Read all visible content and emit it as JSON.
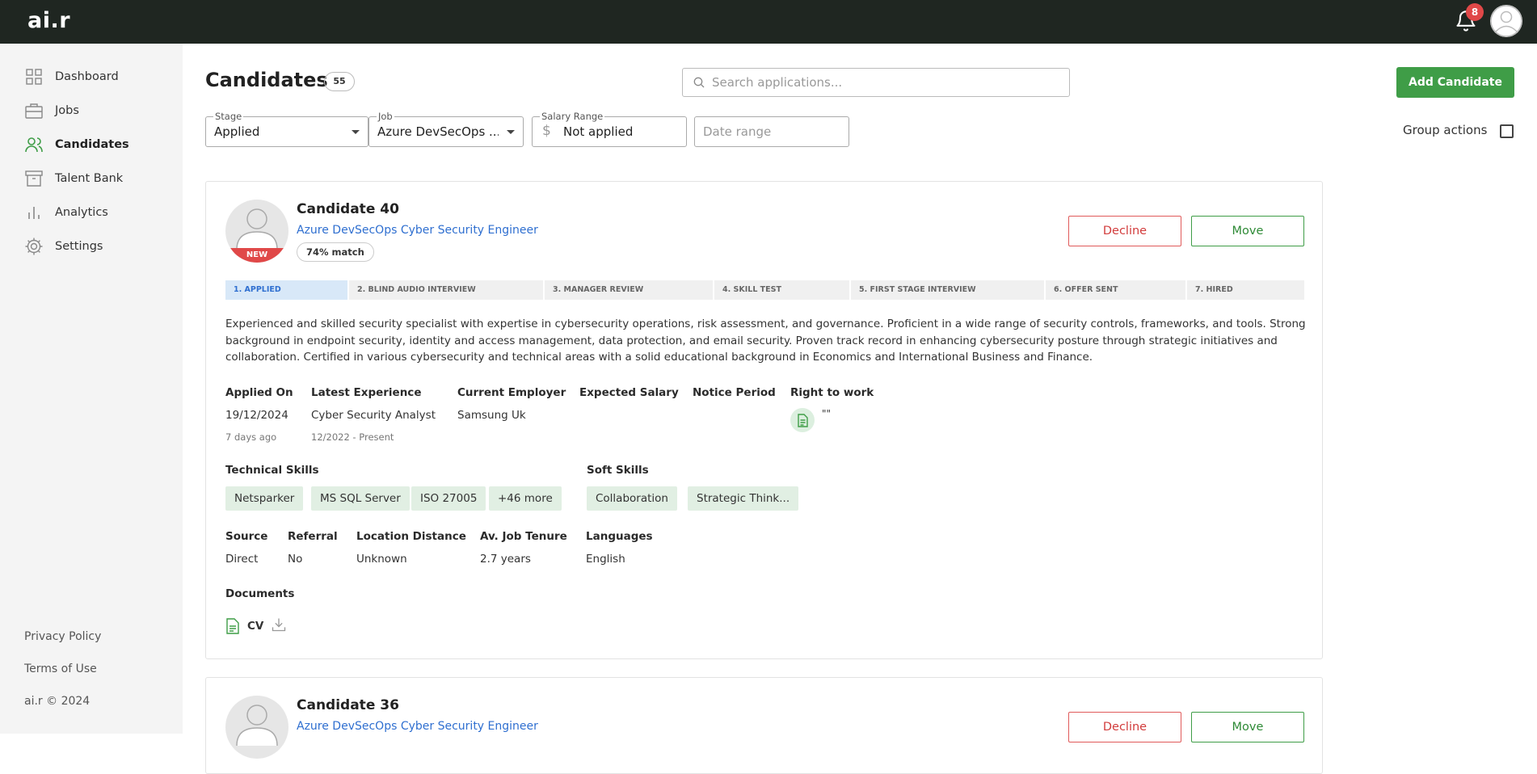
{
  "app": {
    "logo": "ai.r",
    "notifications_count": "8"
  },
  "sidebar": {
    "items": [
      {
        "label": "Dashboard",
        "icon": "grid-icon"
      },
      {
        "label": "Jobs",
        "icon": "briefcase-icon"
      },
      {
        "label": "Candidates",
        "icon": "people-icon",
        "active": true
      },
      {
        "label": "Talent Bank",
        "icon": "archive-icon"
      },
      {
        "label": "Analytics",
        "icon": "bar-chart-icon"
      },
      {
        "label": "Settings",
        "icon": "gear-icon"
      }
    ],
    "footer": {
      "privacy": "Privacy Policy",
      "terms": "Terms of Use",
      "copyright": "ai.r © 2024"
    }
  },
  "header": {
    "title": "Candidates",
    "count": "55",
    "search_placeholder": "Search applications...",
    "add_button": "Add Candidate"
  },
  "filters": {
    "stage": {
      "label": "Stage",
      "value": "Applied"
    },
    "job": {
      "label": "Job",
      "value": "Azure DevSecOps ..."
    },
    "salary": {
      "label": "Salary Range",
      "value": "Not applied"
    },
    "date": {
      "placeholder": "Date range"
    },
    "group_actions": "Group actions"
  },
  "candidates": [
    {
      "name": "Candidate 40",
      "new_tag": "NEW",
      "job": "Azure DevSecOps Cyber Security Engineer",
      "match": "74% match",
      "decline": "Decline",
      "move": "Move",
      "stages": [
        "1. APPLIED",
        "2. BLIND AUDIO INTERVIEW",
        "3. MANAGER REVIEW",
        "4. SKILL TEST",
        "5. FIRST STAGE INTERVIEW",
        "6. OFFER SENT",
        "7. HIRED"
      ],
      "summary": "Experienced and skilled security specialist with expertise in cybersecurity operations, risk assessment, and governance. Proficient in a wide range of security controls, frameworks, and tools. Strong background in endpoint security, identity and access management, data protection, and email security. Proven track record in enhancing cybersecurity posture through strategic initiatives and collaboration. Certified in various cybersecurity and technical areas with a solid educational background in Economics and International Business and Finance.",
      "details": {
        "applied_on_h": "Applied On",
        "applied_on": "19/12/2024",
        "applied_ago": "7 days ago",
        "latest_exp_h": "Latest Experience",
        "latest_exp": "Cyber Security Analyst",
        "latest_exp_period": "12/2022 - Present",
        "employer_h": "Current Employer",
        "employer": "Samsung Uk",
        "salary_h": "Expected Salary",
        "notice_h": "Notice Period",
        "rtw_h": "Right to work",
        "rtw_value": "\"\""
      },
      "tech_skills_h": "Technical Skills",
      "tech_skills": [
        "Netsparker",
        "MS SQL Server",
        "ISO 27005",
        "+46 more"
      ],
      "soft_skills_h": "Soft Skills",
      "soft_skills": [
        "Collaboration",
        "Strategic Think..."
      ],
      "meta": {
        "source_h": "Source",
        "source": "Direct",
        "referral_h": "Referral",
        "referral": "No",
        "distance_h": "Location Distance",
        "distance": "Unknown",
        "tenure_h": "Av. Job Tenure",
        "tenure": "2.7 years",
        "languages_h": "Languages",
        "languages": "English"
      },
      "documents_h": "Documents",
      "documents": [
        "CV"
      ]
    },
    {
      "name": "Candidate 36",
      "job": "Azure DevSecOps Cyber Security Engineer",
      "decline": "Decline",
      "move": "Move"
    }
  ]
}
